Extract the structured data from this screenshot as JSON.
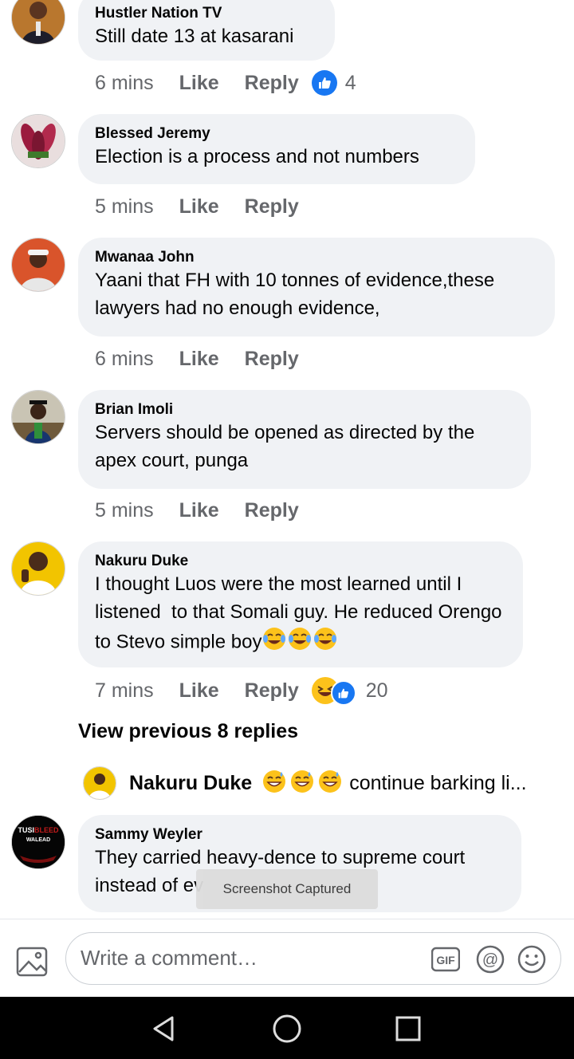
{
  "comments": [
    {
      "author": "Hustler Nation TV",
      "text": "Still date 13 at kasarani",
      "time": "6 mins",
      "like": "Like",
      "reply": "Reply",
      "reaction_count": "4"
    },
    {
      "author": "Blessed Jeremy",
      "text": "Election is a process and not numbers",
      "time": "5 mins",
      "like": "Like",
      "reply": "Reply"
    },
    {
      "author": "Mwanaa John",
      "text": "Yaani that FH with 10 tonnes of evidence,these lawyers had no enough evidence,",
      "time": "6 mins",
      "like": "Like",
      "reply": "Reply"
    },
    {
      "author": "Brian Imoli",
      "text": "Servers should be opened as directed by the apex court, punga",
      "time": "5 mins",
      "like": "Like",
      "reply": "Reply"
    },
    {
      "author": "Nakuru Duke",
      "text": "I thought Luos were the most learned until I listened  to that Somali guy. He reduced Orengo to Stevo simple boy",
      "time": "7 mins",
      "like": "Like",
      "reply": "Reply",
      "reaction_count": "20"
    },
    {
      "author": "Sammy Weyler",
      "text": "They carried heavy-dence to supreme court instead of ev"
    }
  ],
  "view_previous": "View previous 8 replies",
  "reply_preview": {
    "author": "Nakuru Duke",
    "text": "continue barking li..."
  },
  "avatar_logo": {
    "line1": "TUSI",
    "line2": "BLEED",
    "line3": "WALEAD"
  },
  "toast": "Screenshot Captured",
  "composer": {
    "placeholder": "Write a comment…",
    "gif_label": "GIF"
  },
  "colors": {
    "bubble": "#f0f2f5",
    "meta": "#65676b",
    "like_blue": "#1877f2",
    "laugh_yellow": "#fcc21b"
  },
  "icons": [
    "like-reaction-icon",
    "haha-reaction-icon",
    "photo-icon",
    "gif-icon",
    "mention-icon",
    "emoji-icon",
    "back-nav-icon",
    "home-nav-icon",
    "recents-nav-icon"
  ]
}
